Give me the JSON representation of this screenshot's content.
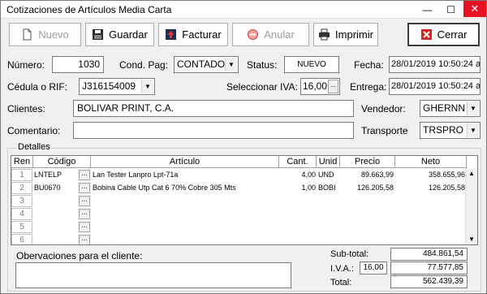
{
  "window": {
    "title": "Cotizaciones de Artículos Media Carta",
    "minimize": "—",
    "maximize": "☐",
    "close": "✕"
  },
  "toolbar": {
    "nuevo": "Nuevo",
    "guardar": "Guardar",
    "facturar": "Facturar",
    "anular": "Anular",
    "imprimir": "Imprimir",
    "cerrar": "Cerrar"
  },
  "form": {
    "numero_label": "Número:",
    "numero": "1030",
    "cond_pag_label": "Cond. Pag:",
    "cond_pag": "CONTADO",
    "status_label": "Status:",
    "status": "NUEVO",
    "fecha_label": "Fecha:",
    "fecha": "28/01/2019 10:50:24 a",
    "cedula_label": "Cédula o RIF:",
    "cedula": "J316154009",
    "iva_select_label": "Seleccionar IVA:",
    "iva_select": "16,00",
    "entrega_label": "Entrega:",
    "entrega": "28/01/2019 10:50:24 a",
    "clientes_label": "Clientes:",
    "cliente": "BOLIVAR PRINT, C.A.",
    "vendedor_label": "Vendedor:",
    "vendedor": "GHERNN",
    "comentario_label": "Comentario:",
    "comentario": "",
    "transporte_label": "Transporte",
    "transporte": "TRSPRO"
  },
  "detalles": {
    "title": "Detalles",
    "columns": {
      "ren": "Ren",
      "codigo": "Código",
      "articulo": "Artículo",
      "cant": "Cant.",
      "unid": "Unid",
      "precio": "Precio",
      "neto": "Neto"
    },
    "rows": [
      {
        "ren": "1",
        "codigo": "LNTELP",
        "articulo": "Lan Tester Lanpro Lpt-71a",
        "cant": "4,00",
        "unid": "UND",
        "precio": "89.663,99",
        "neto": "358.655,96"
      },
      {
        "ren": "2",
        "codigo": "BU0670",
        "articulo": "Bobina Cable Utp Cat 6 70% Cobre 305 Mts",
        "cant": "1,00",
        "unid": "BOBI",
        "precio": "126.205,58",
        "neto": "126.205,58"
      },
      {
        "ren": "3",
        "codigo": "",
        "articulo": "",
        "cant": "",
        "unid": "",
        "precio": "",
        "neto": ""
      },
      {
        "ren": "4",
        "codigo": "",
        "articulo": "",
        "cant": "",
        "unid": "",
        "precio": "",
        "neto": ""
      },
      {
        "ren": "5",
        "codigo": "",
        "articulo": "",
        "cant": "",
        "unid": "",
        "precio": "",
        "neto": ""
      },
      {
        "ren": "6",
        "codigo": "",
        "articulo": "",
        "cant": "",
        "unid": "",
        "precio": "",
        "neto": ""
      }
    ],
    "dots": "..."
  },
  "footer": {
    "observaciones_label": "Obervaciones para el cliente:",
    "observaciones": "",
    "subtotal_label": "Sub-total:",
    "subtotal": "484.861,54",
    "iva_label": "I.V.A.:",
    "iva_rate": "16,00",
    "iva": "77.577,85",
    "total_label": "Total:",
    "total": "562.439,39"
  }
}
